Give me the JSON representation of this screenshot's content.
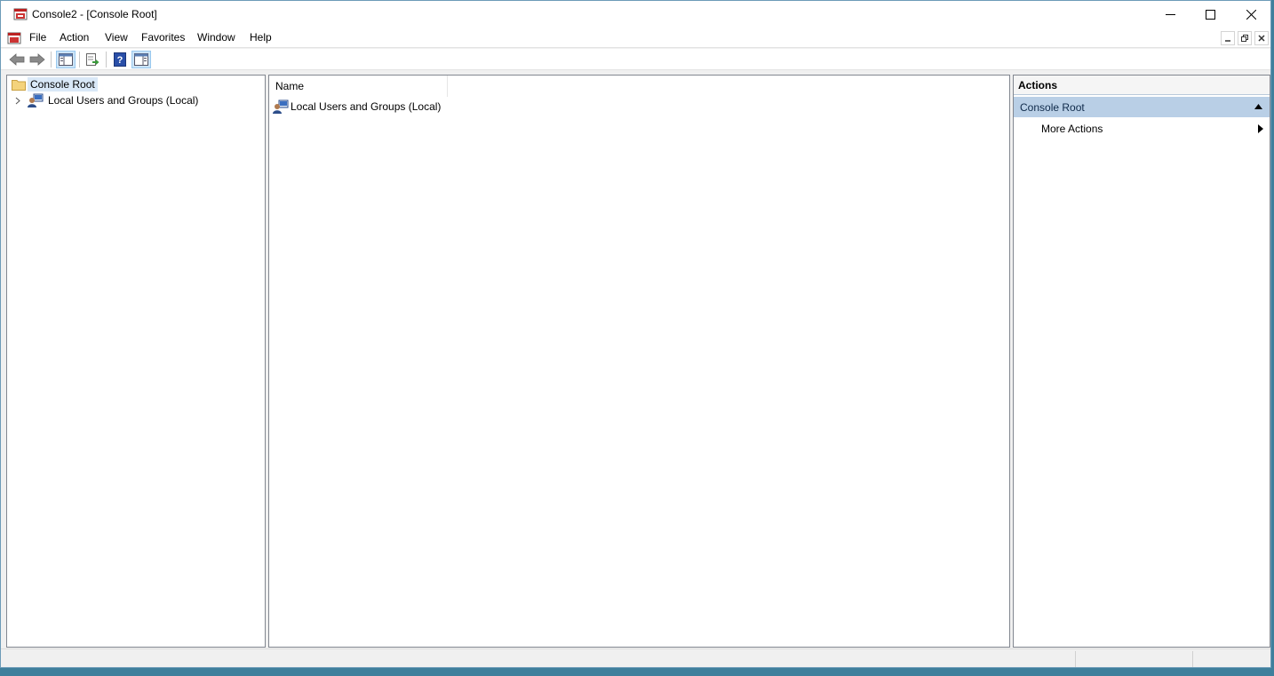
{
  "window": {
    "title": "Console2 - [Console Root]"
  },
  "menu": {
    "items": [
      "File",
      "Action",
      "View",
      "Favorites",
      "Window",
      "Help"
    ]
  },
  "toolbar": {
    "buttons": [
      "back-arrow-icon",
      "forward-arrow-icon",
      "show-hide-console-tree-icon",
      "export-list-icon",
      "help-icon",
      "show-hide-action-pane-icon"
    ]
  },
  "tree": {
    "root_label": "Console Root",
    "child_label": "Local Users and Groups (Local)"
  },
  "list": {
    "column_name": "Name",
    "rows": [
      "Local Users and Groups (Local)"
    ]
  },
  "actions": {
    "header": "Actions",
    "group_label": "Console Root",
    "more_actions": "More Actions"
  },
  "colors": {
    "selection": "#d9e8f7",
    "action_group_bg": "#b9cfe6",
    "pressed_button": "#cce4f7"
  }
}
